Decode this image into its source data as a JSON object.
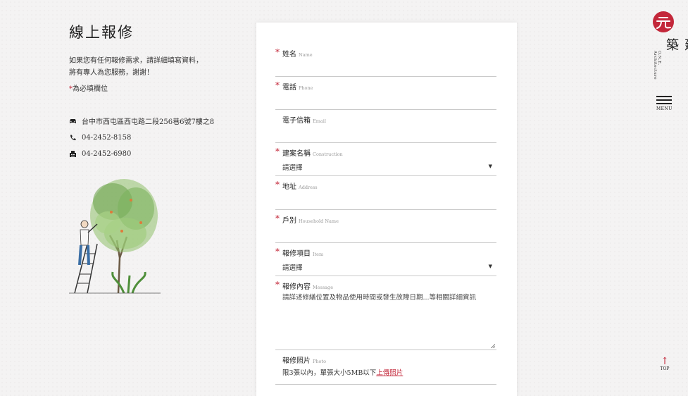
{
  "left": {
    "title": "線上報修",
    "intro_line1": "如果您有任何報修需求，請詳細填寫資料，",
    "intro_line2": "將有專人為您服務，謝謝！",
    "req_star": "*",
    "req_text": "為必填欄位",
    "address": "台中市西屯區西屯路二段256巷6號7樓之8",
    "phone": "04-2452-8158",
    "fax": "04-2452-6980"
  },
  "form": {
    "name": {
      "label": "姓名",
      "en": "Name",
      "required": true
    },
    "phone": {
      "label": "電話",
      "en": "Phone",
      "required": true
    },
    "email": {
      "label": "電子信箱",
      "en": "Email",
      "required": false
    },
    "construction": {
      "label": "建案名稱",
      "en": "Construction",
      "required": true,
      "value": "請選擇"
    },
    "address": {
      "label": "地址",
      "en": "Address",
      "required": true
    },
    "household": {
      "label": "戶別",
      "en": "Household Name",
      "required": true
    },
    "item": {
      "label": "報修項目",
      "en": "Item",
      "required": true,
      "value": "請選擇"
    },
    "message": {
      "label": "報修內容",
      "en": "Message",
      "required": true,
      "placeholder": "請詳述修繕位置及物品使用時間或發生故障日期...等相關詳細資訊"
    },
    "photo": {
      "label": "報修照片",
      "en": "Photo",
      "required": false,
      "hint": "限3張以內，單張大小5MB以下",
      "link": "上傳照片"
    }
  },
  "header": {
    "logo_text": "元建築",
    "logo_sub": "O.N.E. Architecture",
    "menu_label": "MENU",
    "top_label": "TOP",
    "top_arrow": "↑"
  },
  "colors": {
    "accent": "#c3273a",
    "text": "#333333"
  }
}
